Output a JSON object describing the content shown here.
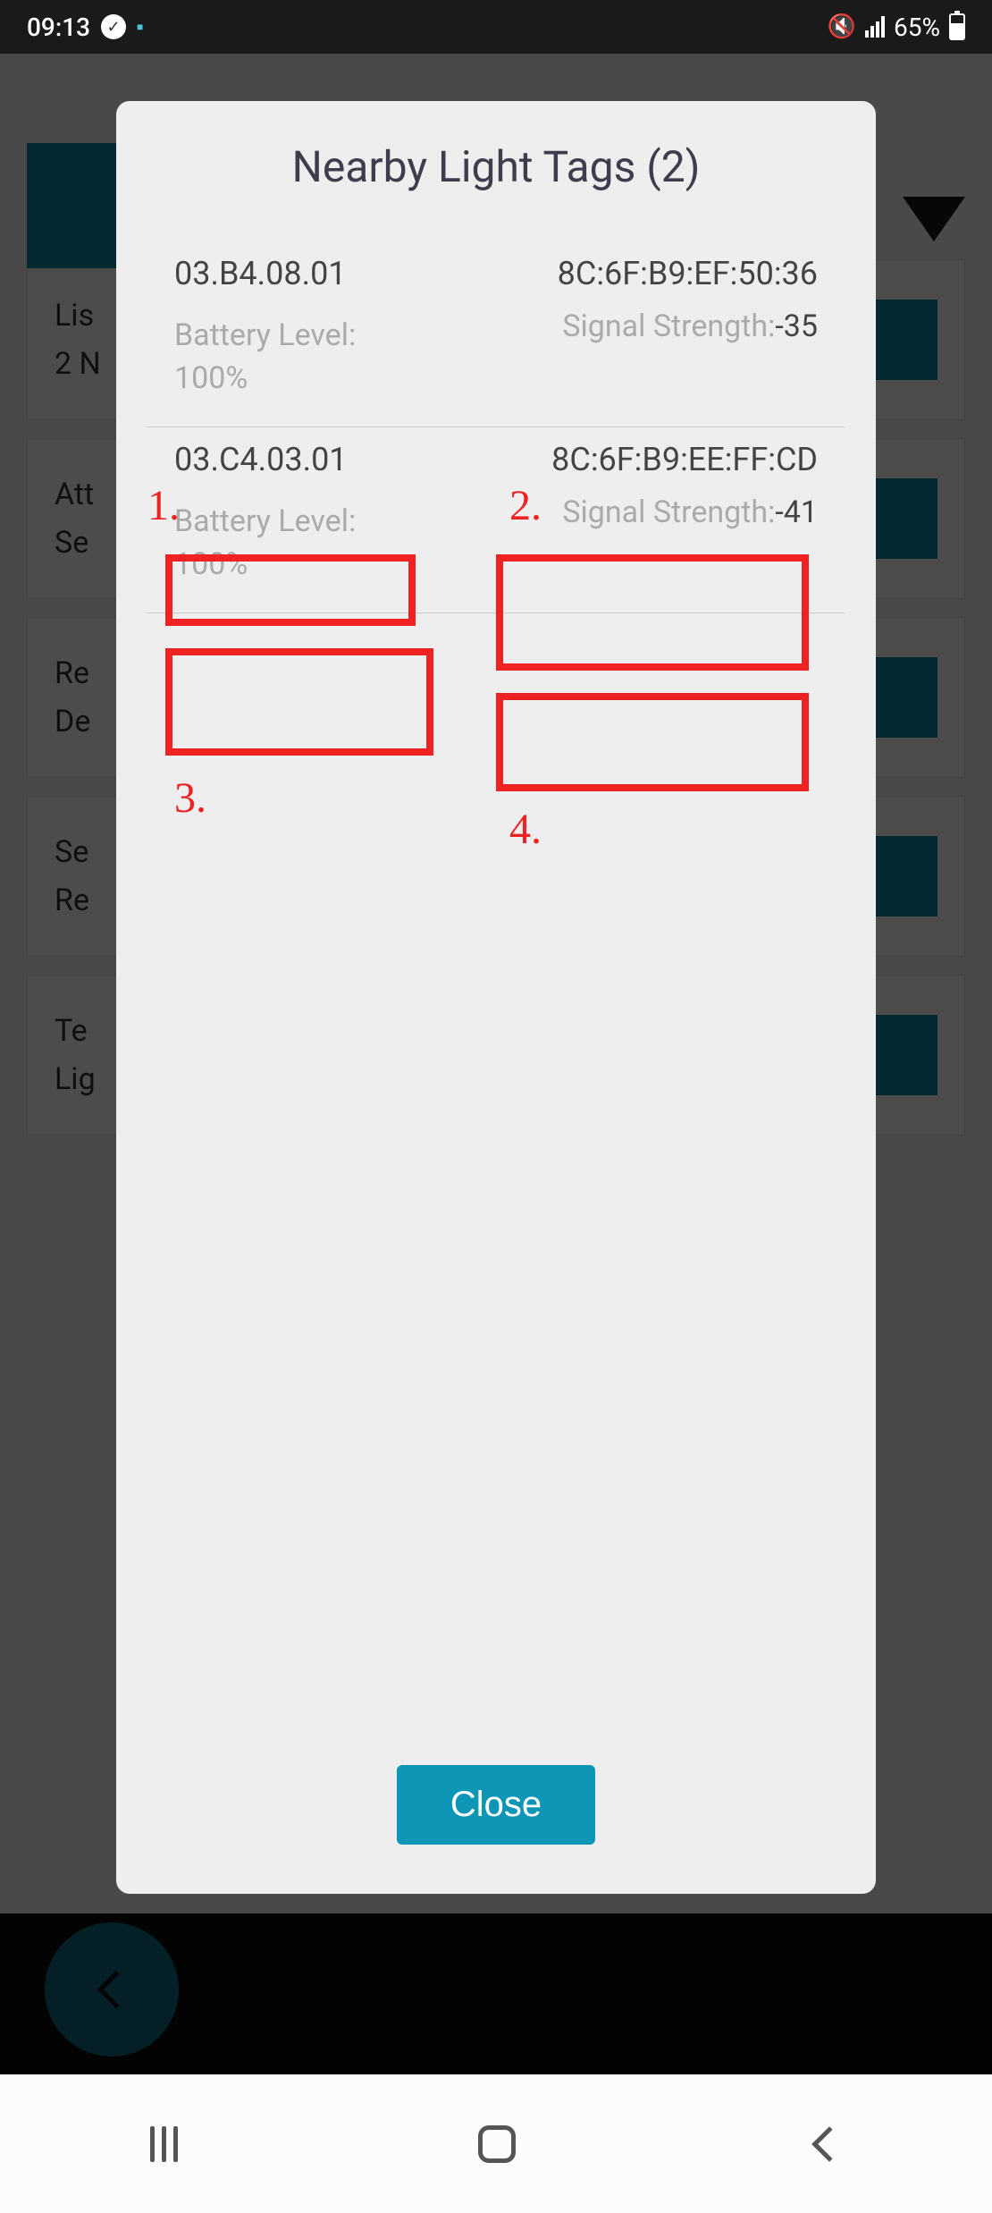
{
  "status": {
    "time": "09:13",
    "battery_percent": "65%"
  },
  "modal": {
    "title": "Nearby Light Tags (2)",
    "close_button": "Close",
    "tags": [
      {
        "id": "03.B4.08.01",
        "mac": "8C:6F:B9:EF:50:36",
        "battery_label": "Battery Level: ",
        "battery_value": "100%",
        "signal_label": "Signal Strength:",
        "signal_value": "-35"
      },
      {
        "id": "03.C4.03.01",
        "mac": "8C:6F:B9:EE:FF:CD",
        "battery_label": "Battery Level: ",
        "battery_value": "100%",
        "signal_label": "Signal Strength:",
        "signal_value": "-41"
      }
    ]
  },
  "annotations": {
    "a1": "1.",
    "a2": "2.",
    "a3": "3.",
    "a4": "4."
  },
  "background": {
    "card0_line1": "Lis",
    "card0_line2": "2 N",
    "card1_line1": "Att",
    "card1_line2": "Se",
    "card2_line1": "Re",
    "card2_line2": "De",
    "card3_line1": "Se",
    "card3_line2": "Re",
    "card4_line1": "Te",
    "card4_line2": "Lig"
  }
}
